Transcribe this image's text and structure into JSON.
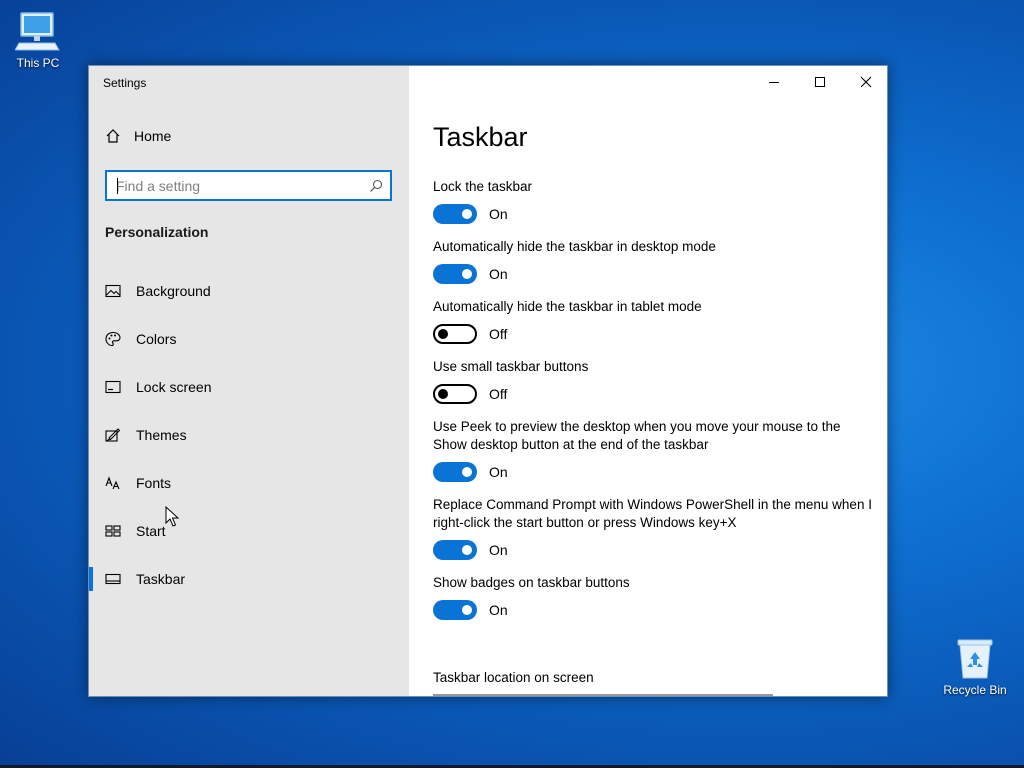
{
  "desktop": {
    "icons": [
      {
        "label": "This PC",
        "icon": "computer-icon"
      },
      {
        "label": "Recycle Bin",
        "icon": "recycle-bin-icon"
      }
    ]
  },
  "window": {
    "title": "Settings",
    "controls": [
      "minimize-icon",
      "maximize-icon",
      "close-icon"
    ]
  },
  "sidebar": {
    "home_label": "Home",
    "search": {
      "placeholder": "Find a setting",
      "value": ""
    },
    "section_title": "Personalization",
    "items": [
      {
        "label": "Background",
        "icon": "picture-icon"
      },
      {
        "label": "Colors",
        "icon": "palette-icon"
      },
      {
        "label": "Lock screen",
        "icon": "lock-screen-icon"
      },
      {
        "label": "Themes",
        "icon": "themes-icon"
      },
      {
        "label": "Fonts",
        "icon": "fonts-icon"
      },
      {
        "label": "Start",
        "icon": "start-icon"
      },
      {
        "label": "Taskbar",
        "icon": "taskbar-icon",
        "active": true
      }
    ]
  },
  "content": {
    "page_title": "Taskbar",
    "settings": [
      {
        "label": "Lock the taskbar",
        "state": "On"
      },
      {
        "label": "Automatically hide the taskbar in desktop mode",
        "state": "On"
      },
      {
        "label": "Automatically hide the taskbar in tablet mode",
        "state": "Off"
      },
      {
        "label": "Use small taskbar buttons",
        "state": "Off"
      },
      {
        "label": "Use Peek to preview the desktop when you move your mouse to the Show desktop button at the end of the taskbar",
        "state": "On"
      },
      {
        "label": "Replace Command Prompt with Windows PowerShell in the menu when I right-click the start button or press Windows key+X",
        "state": "On"
      },
      {
        "label": "Show badges on taskbar buttons",
        "state": "On"
      }
    ],
    "location_label": "Taskbar location on screen"
  },
  "colors": {
    "accent": "#0a74d6",
    "sidebar_bg": "#e6e6e6",
    "desktop_bg": "#0e6fd0"
  }
}
